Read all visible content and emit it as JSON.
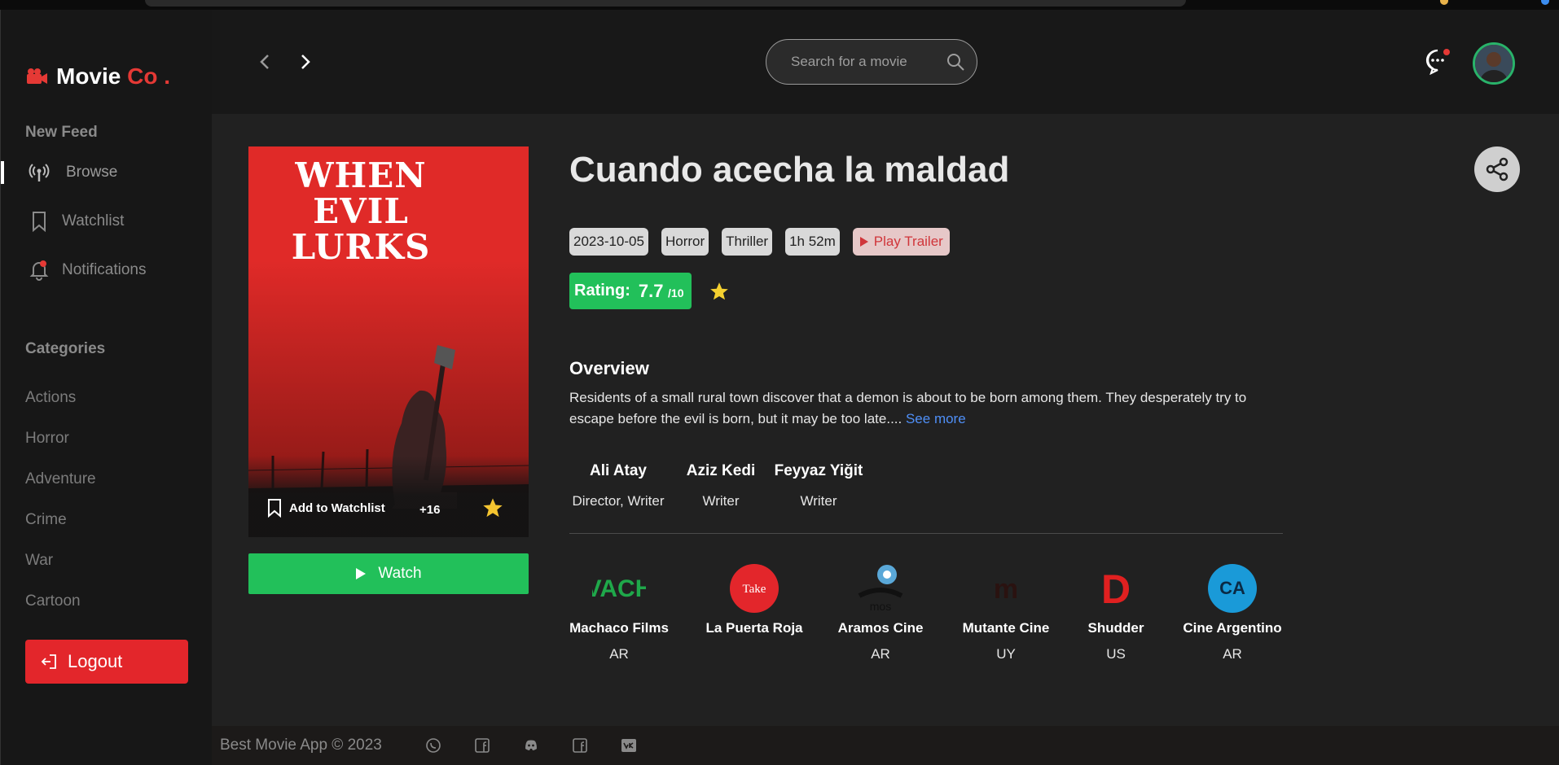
{
  "app": {
    "logo_word": "Movie",
    "logo_accent": "Co .",
    "accent_color": "#e53935",
    "green_color": "#22c05a"
  },
  "sidebar": {
    "section_feed": "New Feed",
    "nav": [
      {
        "label": "Browse",
        "icon": "broadcast-icon",
        "active": true
      },
      {
        "label": "Watchlist",
        "icon": "bookmark-icon",
        "active": false
      },
      {
        "label": "Notifications",
        "icon": "bell-icon",
        "active": false
      }
    ],
    "section_categories": "Categories",
    "categories": [
      "Actions",
      "Horror",
      "Adventure",
      "Crime",
      "War",
      "Cartoon"
    ],
    "logout_label": "Logout"
  },
  "topbar": {
    "search_placeholder": "Search for a movie"
  },
  "movie": {
    "title": "Cuando acecha la maldad",
    "poster_title": "WHEN EVIL LURKS",
    "tags": [
      "2023-10-05",
      "Horror",
      "Thriller",
      "1h 52m"
    ],
    "trailer_label": "Play Trailer",
    "rating_label": "Rating:",
    "rating_value": "7.7",
    "rating_max": "/10",
    "overview_title": "Overview",
    "overview_text": "Residents of a small rural town discover that a demon is about to be born among them. They desperately try to escape before the evil is born, but it may be too late....",
    "see_more": "See more",
    "add_watchlist": "Add to Watchlist",
    "age_rating": "+16",
    "watch_label": "Watch",
    "crew": [
      {
        "name": "Ali Atay",
        "role": "Director, Writer"
      },
      {
        "name": "Aziz Kedi",
        "role": "Writer"
      },
      {
        "name": "Feyyaz Yiğit",
        "role": "Writer"
      }
    ],
    "companies": [
      {
        "name": "Machaco Films",
        "country": "AR",
        "logo": "VACH"
      },
      {
        "name": "La Puerta Roja",
        "country": "",
        "logo": "Take"
      },
      {
        "name": "Aramos Cine",
        "country": "AR",
        "logo": "mos"
      },
      {
        "name": "Mutante Cine",
        "country": "UY",
        "logo": "m"
      },
      {
        "name": "Shudder",
        "country": "US",
        "logo": "D"
      },
      {
        "name": "Cine Argentino",
        "country": "AR",
        "logo": "CA"
      }
    ]
  },
  "footer": {
    "copyright": "Best Movie App © 2023",
    "social_icons": [
      "whatsapp-icon",
      "facebook-icon",
      "discord-icon",
      "facebook-icon",
      "vk-icon"
    ]
  }
}
